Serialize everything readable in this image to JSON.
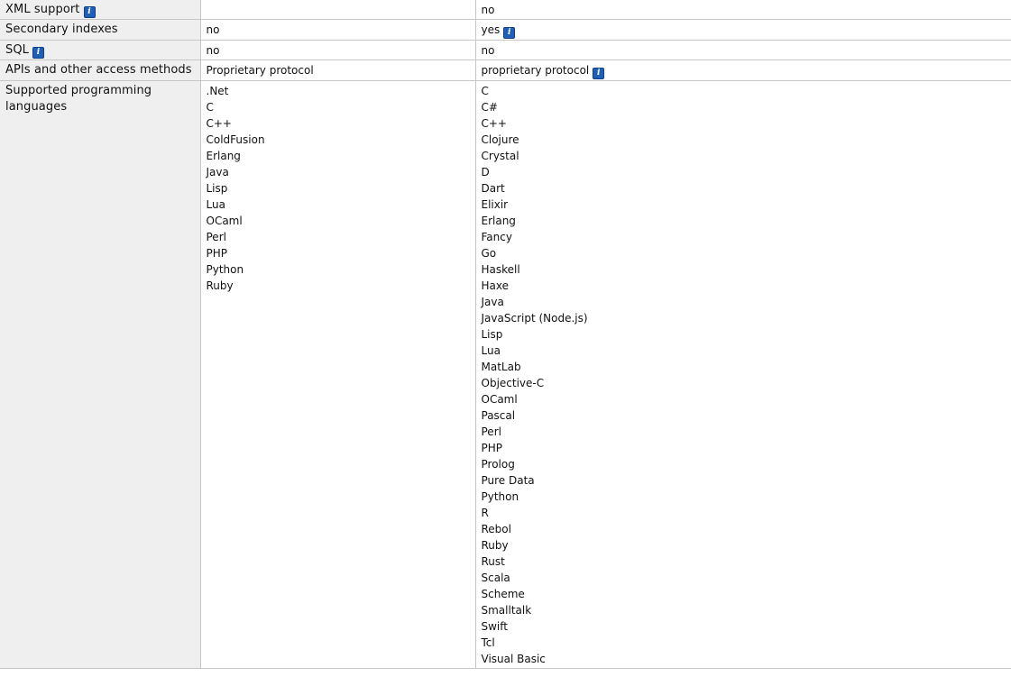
{
  "info_glyph": "i",
  "rows": [
    {
      "label": "XML support",
      "a": "",
      "b": "no"
    },
    {
      "label": "Secondary indexes",
      "a": "no",
      "b": "yes"
    },
    {
      "label": "SQL",
      "a": "no",
      "b": "no"
    },
    {
      "label": "APIs and other access methods",
      "a": "Proprietary protocol",
      "b": "proprietary protocol"
    },
    {
      "label": "Supported programming languages",
      "a_list": [
        ".Net",
        "C",
        "C++",
        "ColdFusion",
        "Erlang",
        "Java",
        "Lisp",
        "Lua",
        "OCaml",
        "Perl",
        "PHP",
        "Python",
        "Ruby"
      ],
      "b_list": [
        "C",
        "C#",
        "C++",
        "Clojure",
        "Crystal",
        "D",
        "Dart",
        "Elixir",
        "Erlang",
        "Fancy",
        "Go",
        "Haskell",
        "Haxe",
        "Java",
        "JavaScript (Node.js)",
        "Lisp",
        "Lua",
        "MatLab",
        "Objective-C",
        "OCaml",
        "Pascal",
        "Perl",
        "PHP",
        "Prolog",
        "Pure Data",
        "Python",
        "R",
        "Rebol",
        "Ruby",
        "Rust",
        "Scala",
        "Scheme",
        "Smalltalk",
        "Swift",
        "Tcl",
        "Visual Basic"
      ]
    }
  ]
}
